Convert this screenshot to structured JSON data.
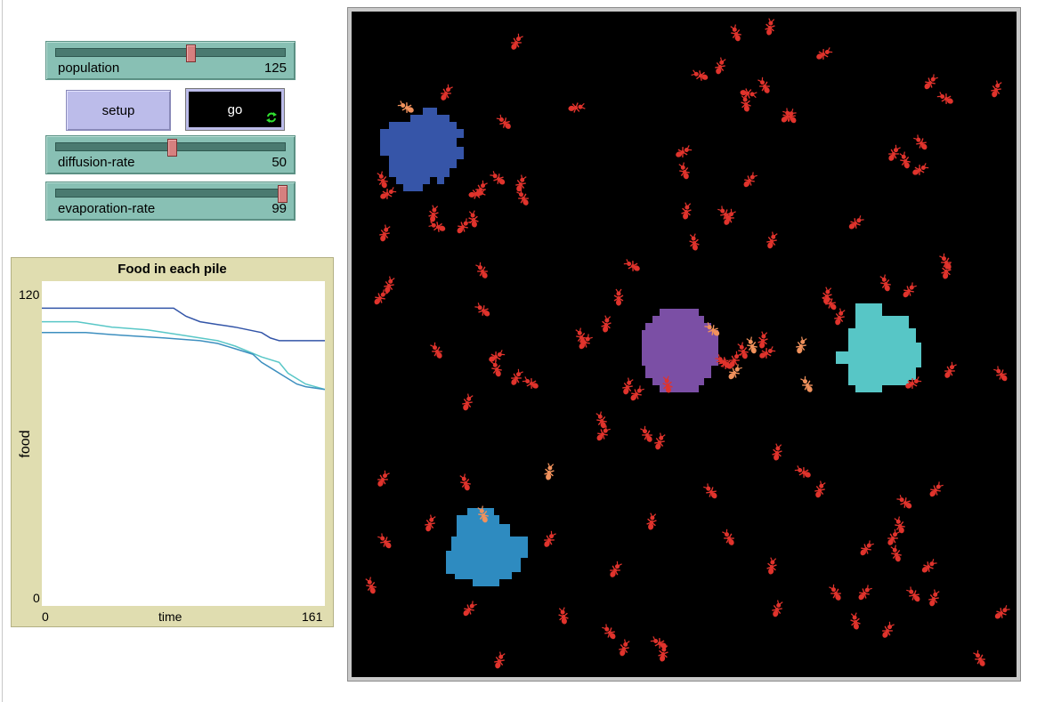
{
  "sliders": [
    {
      "id": "population",
      "label": "population",
      "value": "125",
      "fraction": 0.586
    },
    {
      "id": "diffusion-rate",
      "label": "diffusion-rate",
      "value": "50",
      "fraction": 0.505
    },
    {
      "id": "evaporation-rate",
      "label": "evaporation-rate",
      "value": "99",
      "fraction": 0.99
    }
  ],
  "buttons": {
    "setup_label": "setup",
    "go_label": "go",
    "go_forever_icon": "forever-arrows-icon"
  },
  "plot": {
    "title": "Food in each pile",
    "y_max_label": "120",
    "y_min_label": "0",
    "x_min_label": "0",
    "x_max_label": "161",
    "xlabel": "time",
    "ylabel": "food"
  },
  "chart_data": {
    "type": "line",
    "title": "Food in each pile",
    "xlabel": "time",
    "ylabel": "food",
    "xlim": [
      0,
      161
    ],
    "ylim": [
      0,
      120
    ],
    "series": [
      {
        "color": "#3355a8",
        "x": [
          0,
          75,
          82,
          90,
          100,
          110,
          125,
          130,
          135,
          140,
          161
        ],
        "y": [
          110,
          110,
          107,
          105,
          104,
          103,
          101,
          99,
          98,
          98,
          98
        ]
      },
      {
        "color": "#59c7c7",
        "x": [
          0,
          20,
          40,
          60,
          70,
          80,
          100,
          110,
          125,
          135,
          140,
          145,
          150,
          161
        ],
        "y": [
          105,
          105,
          103,
          102,
          101,
          100,
          98,
          96,
          92,
          90,
          86,
          84,
          82,
          80
        ]
      },
      {
        "color": "#3d8fbf",
        "x": [
          0,
          25,
          45,
          70,
          90,
          100,
          110,
          120,
          125,
          130,
          140,
          145,
          150,
          161
        ],
        "y": [
          101,
          101,
          100,
          99,
          98,
          97,
          95,
          93,
          90,
          88,
          84,
          82,
          81,
          80
        ]
      }
    ]
  },
  "world": {
    "background": "#000000",
    "food_piles": [
      {
        "name": "blue-pile",
        "color": "#3655a8"
      },
      {
        "name": "purple-pile",
        "color": "#7b4fa5"
      },
      {
        "name": "cyan-pile",
        "color": "#57c6c6"
      },
      {
        "name": "steelblue-pile",
        "color": "#2e8bc0"
      }
    ],
    "ant_color": "#e0332c",
    "carrying_ant_color": "#f0915c",
    "ant_icon": "ant-icon"
  }
}
